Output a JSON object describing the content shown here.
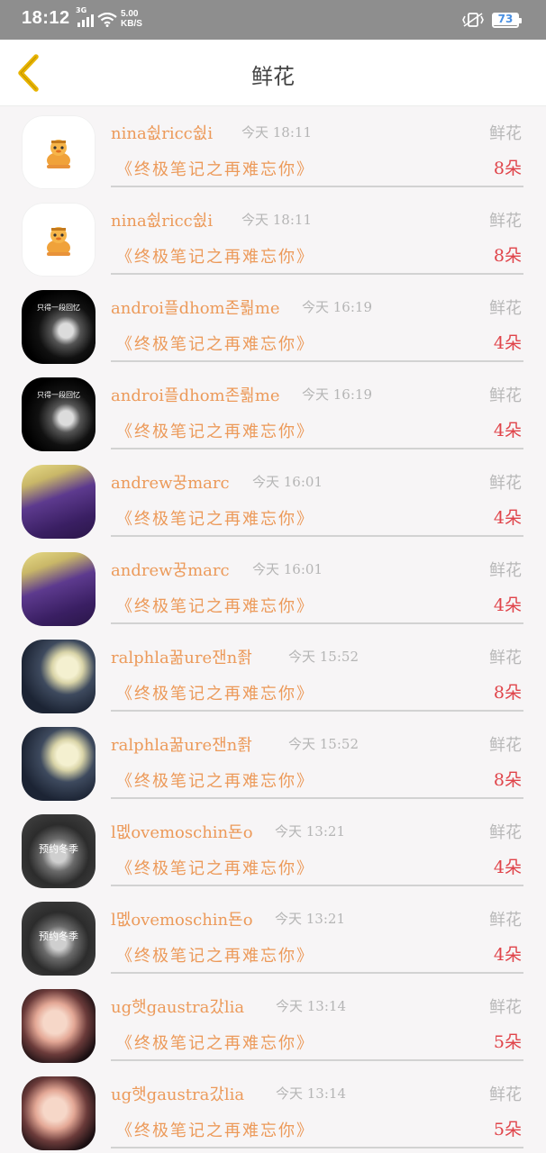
{
  "status_bar": {
    "time": "18:12",
    "network": "3G",
    "speed_value": "5.00",
    "speed_unit": "KB/S",
    "battery": "73"
  },
  "header": {
    "title": "鲜花",
    "back_icon": "chevron-left-icon",
    "accent_color": "#e8b400"
  },
  "list": [
    {
      "name": "nina쉆ricc쉆i",
      "time": "今天 18:11",
      "gift_type": "鲜花",
      "message": "《终极笔记之再难忘你》",
      "quantity": "8朵",
      "avatar": "duck"
    },
    {
      "name": "nina쉆ricc쉆i",
      "time": "今天 18:11",
      "gift_type": "鲜花",
      "message": "《终极笔记之再难忘你》",
      "quantity": "8朵",
      "avatar": "duck"
    },
    {
      "name": "androi플dhom존뤎me",
      "time": "今天 16:19",
      "gift_type": "鲜花",
      "message": "《终极笔记之再难忘你》",
      "quantity": "4朵",
      "avatar": "dark",
      "avatar_text": "只得一段回忆"
    },
    {
      "name": "androi플dhom존뤎me",
      "time": "今天 16:19",
      "gift_type": "鲜花",
      "message": "《终极笔记之再难忘你》",
      "quantity": "4朵",
      "avatar": "dark",
      "avatar_text": "只得一段回忆"
    },
    {
      "name": "andrew꿍marc",
      "time": "今天 16:01",
      "gift_type": "鲜花",
      "message": "《终极笔记之再难忘你》",
      "quantity": "4朵",
      "avatar": "purple"
    },
    {
      "name": "andrew꿍marc",
      "time": "今天 16:01",
      "gift_type": "鲜花",
      "message": "《终极笔记之再难忘你》",
      "quantity": "4朵",
      "avatar": "purple"
    },
    {
      "name": "ralphla꿂ure잰n좕",
      "time": "今天 15:52",
      "gift_type": "鲜花",
      "message": "《终极笔记之再难忘你》",
      "quantity": "8朵",
      "avatar": "flower"
    },
    {
      "name": "ralphla꿂ure잰n좕",
      "time": "今天 15:52",
      "gift_type": "鲜花",
      "message": "《终极笔记之再难忘你》",
      "quantity": "8朵",
      "avatar": "flower"
    },
    {
      "name": "l멦ovemoschin됸o",
      "time": "今天 13:21",
      "gift_type": "鲜花",
      "message": "《终极笔记之再难忘你》",
      "quantity": "4朵",
      "avatar": "winter",
      "avatar_text": "预约冬季"
    },
    {
      "name": "l멦ovemoschin됸o",
      "time": "今天 13:21",
      "gift_type": "鲜花",
      "message": "《终极笔记之再难忘你》",
      "quantity": "4朵",
      "avatar": "winter",
      "avatar_text": "预约冬季"
    },
    {
      "name": "ug햇gaustra갔lia",
      "time": "今天 13:14",
      "gift_type": "鲜花",
      "message": "《终极笔记之再难忘你》",
      "quantity": "5朵",
      "avatar": "girl"
    },
    {
      "name": "ug햇gaustra갔lia",
      "time": "今天 13:14",
      "gift_type": "鲜花",
      "message": "《终极笔记之再难忘你》",
      "quantity": "5朵",
      "avatar": "girl"
    }
  ]
}
